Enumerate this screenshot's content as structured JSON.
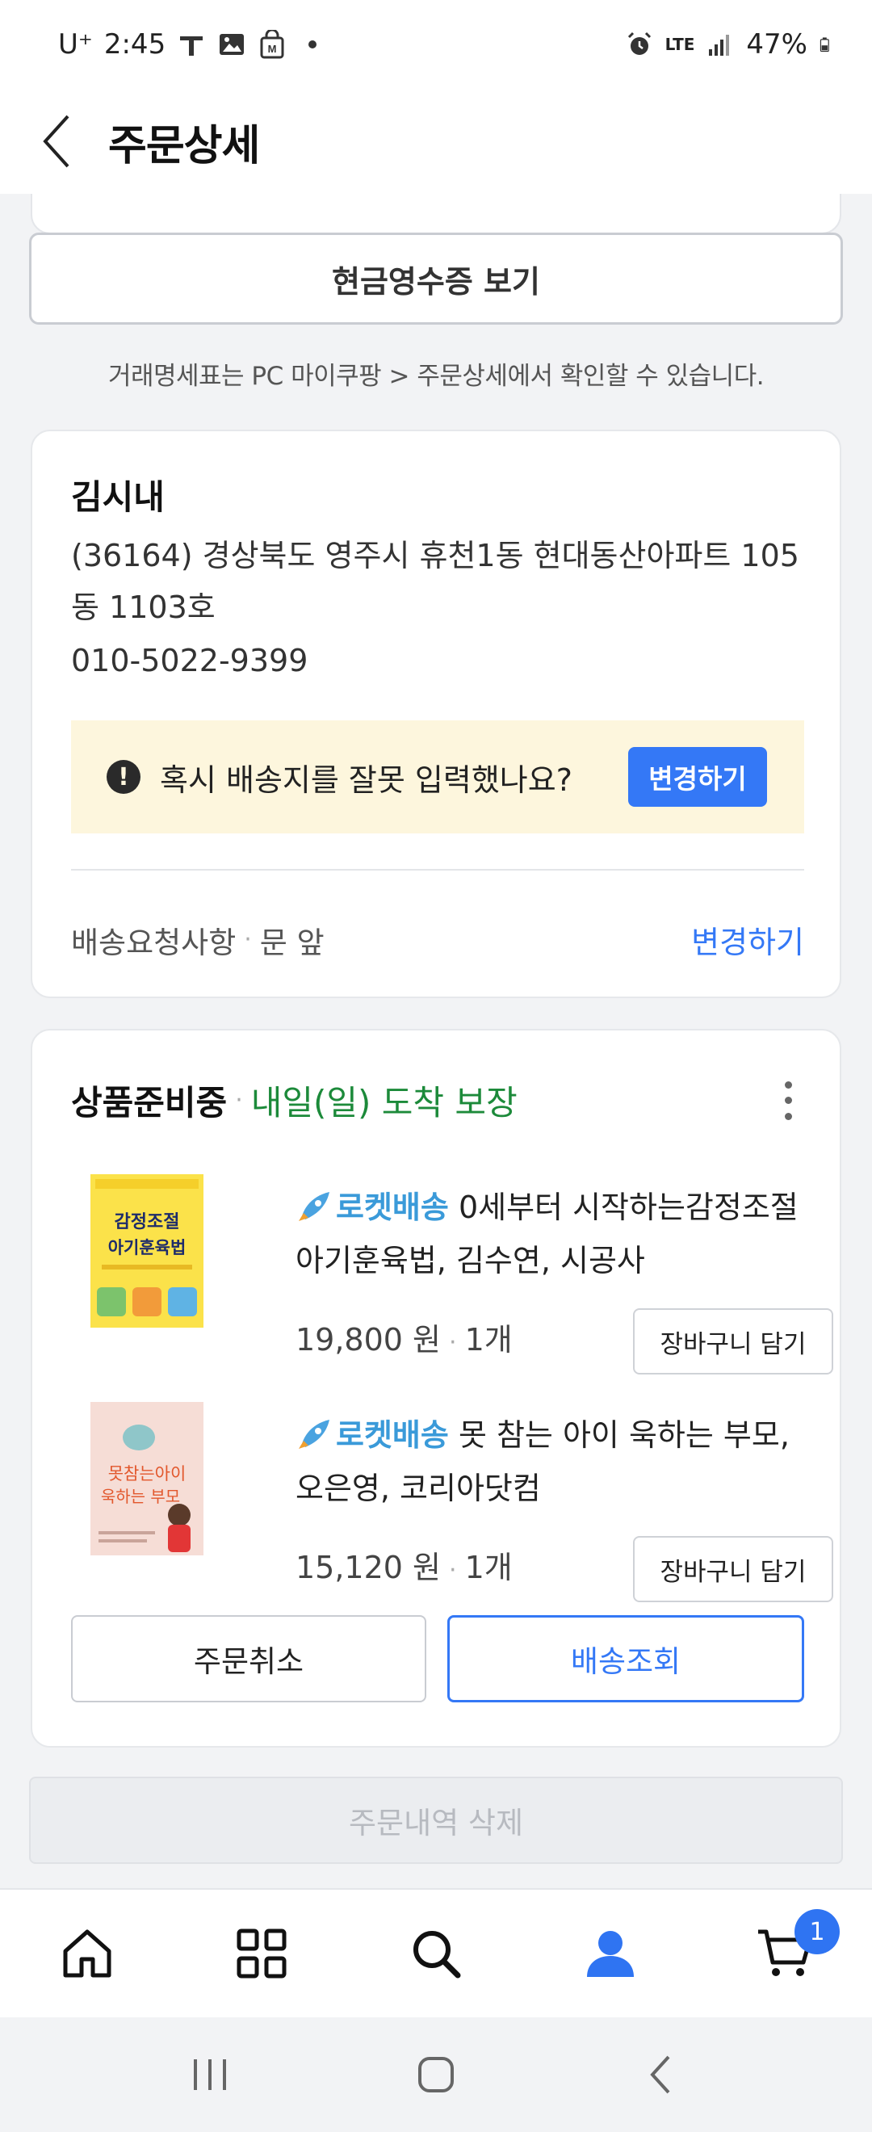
{
  "status_bar": {
    "carrier": "U⁺",
    "time": "2:45",
    "network": "LTE",
    "battery": "47%"
  },
  "header": {
    "title": "주문상세"
  },
  "receipt": {
    "button_label": "현금영수증 보기",
    "notice": "거래명세표는 PC 마이쿠팡 > 주문상세에서 확인할 수 있습니다."
  },
  "shipping": {
    "recipient": "김시내",
    "address": "(36164) 경상북도 영주시 휴천1동 현대동산아파트 105동 1103호",
    "phone": "010-5022-9399",
    "warning_icon": "!",
    "warning_text": "혹시 배송지를 잘못 입력했나요?",
    "warning_button": "변경하기",
    "request_label": "배송요청사항",
    "request_separator": "·",
    "request_value": "문 앞",
    "request_change": "변경하기"
  },
  "order": {
    "status": "상품준비중",
    "separator": "·",
    "promise": "내일(일) 도착 보장",
    "items": [
      {
        "badge": "로켓배송",
        "title": "0세부터 시작하는감정조절 아기훈육법, 김수연, 시공사",
        "price": "19,800 원",
        "separator": "·",
        "qty": "1개",
        "cart_button": "장바구니 담기",
        "cover_lines": [
          "감정조절",
          "아기훈육법"
        ]
      },
      {
        "badge": "로켓배송",
        "title": "못 참는 아이 욱하는 부모, 오은영, 코리아닷컴",
        "price": "15,120 원",
        "separator": "·",
        "qty": "1개",
        "cart_button": "장바구니 담기",
        "cover_lines": [
          "못참는아이",
          "욱하는 부모"
        ]
      }
    ],
    "cancel_button": "주문취소",
    "track_button": "배송조회"
  },
  "delete_button": "주문내역 삭제",
  "bottom_nav": {
    "items": [
      "home-icon",
      "categories-icon",
      "search-icon",
      "my-account-icon",
      "cart-icon"
    ],
    "active": "my-account-icon",
    "active_color": "#2f74f2",
    "cart_badge": "1"
  },
  "colors": {
    "accent": "#3478f6",
    "promise": "#1c8a3a",
    "rocket": "#3a9ad9",
    "warning_bg": "#fdf6dd"
  }
}
